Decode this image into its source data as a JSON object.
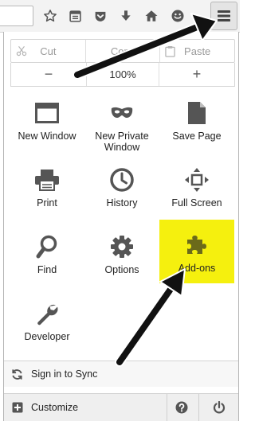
{
  "colors": {
    "icon": "#555555",
    "highlight": "#f5f00e",
    "addon_icon": "#6b6a1a",
    "arrow": "#111111"
  },
  "toolbar": {
    "bookmark_icon": "star-icon",
    "reading_list_icon": "reading-list-icon",
    "pocket_icon": "pocket-icon",
    "downloads_icon": "download-icon",
    "home_icon": "home-icon",
    "social_icon": "smiley-icon",
    "menu_icon": "hamburger-menu-icon"
  },
  "edit": {
    "cut": "Cut",
    "copy": "Copy",
    "paste": "Paste"
  },
  "zoom": {
    "out": "−",
    "level": "100%",
    "in": "+"
  },
  "menu": {
    "new_window": "New Window",
    "new_private_window_line1": "New Private",
    "new_private_window_line2": "Window",
    "save_page": "Save Page",
    "print": "Print",
    "history": "History",
    "full_screen": "Full Screen",
    "find": "Find",
    "options": "Options",
    "addons": "Add-ons",
    "developer": "Developer"
  },
  "footer": {
    "sign_in": "Sign in to Sync",
    "customize": "Customize",
    "help_icon": "help-icon",
    "quit_icon": "power-icon"
  }
}
